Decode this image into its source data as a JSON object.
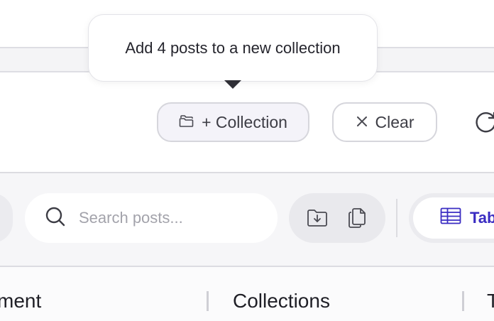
{
  "tooltip": {
    "text": "Add 4 posts to a new collection"
  },
  "actions": {
    "collection_label": "+ Collection",
    "clear_label": "Clear"
  },
  "search": {
    "placeholder": "Search posts..."
  },
  "toolbar": {
    "view_label": "Table",
    "icons": [
      "folder-download-icon",
      "copy-icon",
      "table-icon",
      "refresh-icon",
      "search-icon"
    ]
  },
  "table": {
    "columns": [
      "ment",
      "Collections",
      "T"
    ]
  },
  "colors": {
    "accent": "#3a2cc2",
    "text": "#2a2a33",
    "border": "#d6d6dc"
  }
}
